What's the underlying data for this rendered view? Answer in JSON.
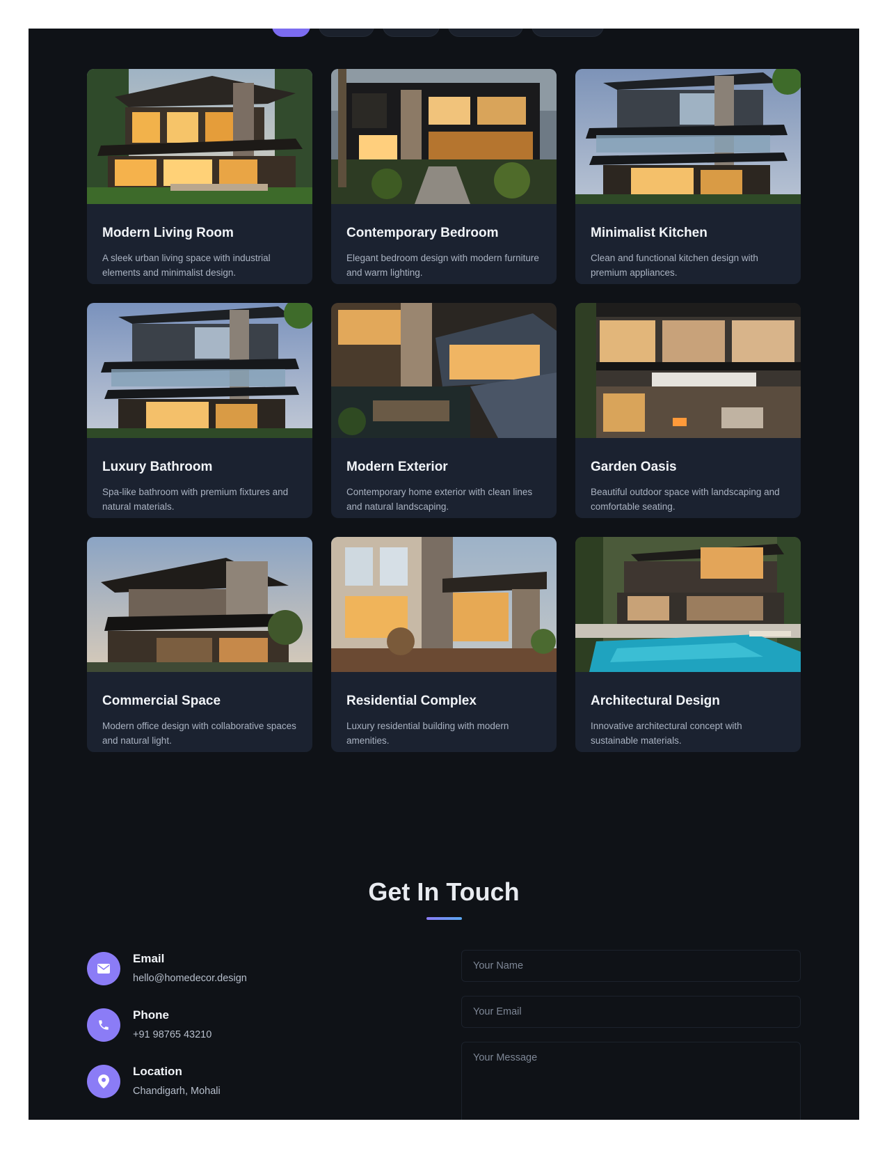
{
  "filters": {
    "count": 5
  },
  "projects": [
    {
      "title": "Modern Living Room",
      "description": "A sleek urban living space with industrial elements and minimalist design.",
      "image": "modern-stone-house-photo"
    },
    {
      "title": "Contemporary Bedroom",
      "description": "Elegant bedroom design with modern furniture and warm lighting.",
      "image": "dark-modern-house-photo"
    },
    {
      "title": "Minimalist Kitchen",
      "description": "Clean and functional kitchen design with premium appliances.",
      "image": "glass-balcony-house-photo"
    },
    {
      "title": "Luxury Bathroom",
      "description": "Spa-like bathroom with premium fixtures and natural materials.",
      "image": "glass-balcony-house-photo"
    },
    {
      "title": "Modern Exterior",
      "description": "Contemporary home exterior with clean lines and natural landscaping.",
      "image": "stone-house-courtyard-photo"
    },
    {
      "title": "Garden Oasis",
      "description": "Beautiful outdoor space with landscaping and comfortable seating.",
      "image": "glass-house-terrace-photo"
    },
    {
      "title": "Commercial Space",
      "description": "Modern office design with collaborative spaces and natural light.",
      "image": "cantilever-house-photo"
    },
    {
      "title": "Residential Complex",
      "description": "Luxury residential building with modern amenities.",
      "image": "stone-patio-house-photo"
    },
    {
      "title": "Architectural Design",
      "description": "Innovative architectural concept with sustainable materials.",
      "image": "pool-house-photo"
    }
  ],
  "contact": {
    "title": "Get In Touch",
    "items": [
      {
        "label": "Email",
        "value": "hello@homedecor.design",
        "icon": "envelope-icon"
      },
      {
        "label": "Phone",
        "value": "+91 98765 43210",
        "icon": "phone-icon"
      },
      {
        "label": "Location",
        "value": "Chandigarh, Mohali",
        "icon": "map-pin-icon"
      }
    ],
    "form": {
      "name_placeholder": "Your Name",
      "email_placeholder": "Your Email",
      "message_placeholder": "Your Message"
    }
  },
  "colors": {
    "background": "#0f1217",
    "card": "#1b2230",
    "accent": "#8b7cf6"
  }
}
